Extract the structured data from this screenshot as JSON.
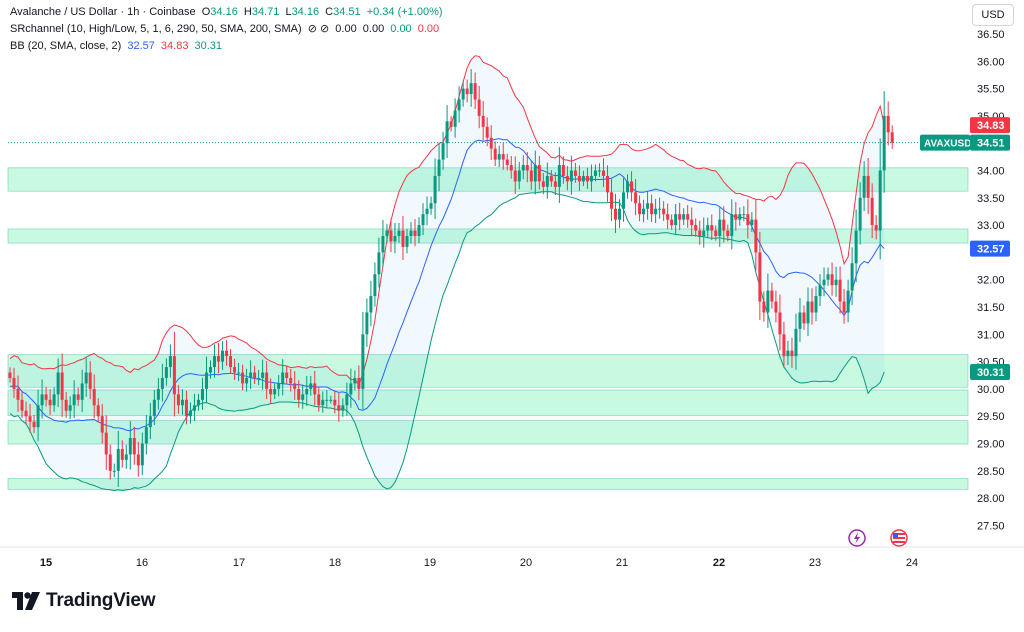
{
  "legend": {
    "symbol_title": "Avalanche / US Dollar · 1h · Coinbase",
    "o_label": "O",
    "o_val": "34.16",
    "h_label": "H",
    "h_val": "34.71",
    "l_label": "L",
    "l_val": "34.16",
    "c_label": "C",
    "c_val": "34.51",
    "change": "+0.34 (+1.00%)",
    "sr_title": "SRchannel (10, High/Low, 5, 1, 6, 290, 50, SMA, 200, SMA)",
    "sr_symbols": "⊘ ⊘",
    "sr_v1": "0.00",
    "sr_v2": "0.00",
    "sr_v3": "0.00",
    "sr_v4": "0.00",
    "bb_title": "BB (20, SMA, close, 2)",
    "bb_basis": "32.57",
    "bb_upper": "34.83",
    "bb_lower": "30.31"
  },
  "currency_button": "USD",
  "branding": {
    "logo_text": "TradingView"
  },
  "chart_data": {
    "type": "candlestick",
    "symbol": "AVAXUSD",
    "x_ticks": [
      "15",
      "16",
      "17",
      "18",
      "19",
      "20",
      "21",
      "22",
      "23",
      "24"
    ],
    "y_ticks": [
      "36.50",
      "36.00",
      "35.50",
      "35.00",
      "34.50",
      "34.00",
      "33.50",
      "33.00",
      "32.50",
      "32.00",
      "31.50",
      "31.00",
      "30.50",
      "30.00",
      "29.50",
      "29.00",
      "28.50",
      "28.00",
      "27.50"
    ],
    "ylim": [
      27.3,
      36.8
    ],
    "price_labels": [
      {
        "text": "34.83",
        "value": 34.83,
        "color": "#f23645"
      },
      {
        "text": "34.51",
        "value": 34.51,
        "color": "#089981",
        "symbol": "AVAXUSD"
      },
      {
        "text": "32.57",
        "value": 32.57,
        "color": "#2962ff"
      },
      {
        "text": "30.31",
        "value": 30.31,
        "color": "#089981"
      }
    ],
    "sr_zones": [
      [
        33.62,
        34.05
      ],
      [
        32.67,
        32.93
      ],
      [
        30.03,
        30.63
      ],
      [
        29.51,
        29.98
      ],
      [
        28.99,
        29.42
      ],
      [
        28.16,
        28.36
      ]
    ],
    "close": [
      30.2,
      30.0,
      29.8,
      29.6,
      29.5,
      29.4,
      29.3,
      29.7,
      29.9,
      29.8,
      29.7,
      29.9,
      30.3,
      29.8,
      29.6,
      29.7,
      29.9,
      29.8,
      30.1,
      30.3,
      30.0,
      29.7,
      29.5,
      29.2,
      28.8,
      28.5,
      28.5,
      28.9,
      28.7,
      28.8,
      29.1,
      28.8,
      28.6,
      29.0,
      29.3,
      29.5,
      29.8,
      30.0,
      30.2,
      30.4,
      30.6,
      29.9,
      29.7,
      29.8,
      29.5,
      29.6,
      29.7,
      29.8,
      30.0,
      30.3,
      30.4,
      30.6,
      30.5,
      30.7,
      30.6,
      30.4,
      30.3,
      30.3,
      30.1,
      30.2,
      30.3,
      30.2,
      30.2,
      30.3,
      30.0,
      29.9,
      30.0,
      30.1,
      30.3,
      30.2,
      30.1,
      30.0,
      29.8,
      29.9,
      30.0,
      30.1,
      29.9,
      29.7,
      29.8,
      29.8,
      29.8,
      29.7,
      29.6,
      29.7,
      29.9,
      30.1,
      30.2,
      30.0,
      31.0,
      31.4,
      31.7,
      32.1,
      32.5,
      32.8,
      32.9,
      32.7,
      32.8,
      32.9,
      32.6,
      32.8,
      32.9,
      32.8,
      33.0,
      33.2,
      33.3,
      33.4,
      33.9,
      34.2,
      34.5,
      34.9,
      34.8,
      35.1,
      35.3,
      35.5,
      35.4,
      35.6,
      35.3,
      35.0,
      34.8,
      34.6,
      34.4,
      34.2,
      34.3,
      34.2,
      34.1,
      34.0,
      33.8,
      34.0,
      34.1,
      34.0,
      33.8,
      34.1,
      33.8,
      33.7,
      33.9,
      33.8,
      33.7,
      34.1,
      33.9,
      33.8,
      34.0,
      33.9,
      33.8,
      33.9,
      33.8,
      33.9,
      34.0,
      34.0,
      33.9,
      33.6,
      33.3,
      33.1,
      33.3,
      33.6,
      33.8,
      33.6,
      33.4,
      33.2,
      33.3,
      33.4,
      33.2,
      33.3,
      33.3,
      33.2,
      33.1,
      33.0,
      33.2,
      33.1,
      33.2,
      33.1,
      33.0,
      32.9,
      32.8,
      32.9,
      33.0,
      32.9,
      32.8,
      33.1,
      32.9,
      32.8,
      33.2,
      33.1,
      33.2,
      33.2,
      33.0,
      33.1,
      32.5,
      31.6,
      31.4,
      31.8,
      31.6,
      31.4,
      31.0,
      30.6,
      30.7,
      30.6,
      31.1,
      31.4,
      31.2,
      31.6,
      31.4,
      31.7,
      31.9,
      32.0,
      32.1,
      31.9,
      32.0,
      31.6,
      31.4,
      31.8,
      32.3,
      32.9,
      33.5,
      33.9,
      33.5,
      33.0,
      32.9,
      34.0,
      35.0,
      34.7,
      34.51
    ],
    "bb_upper": [
      30.55,
      30.61,
      30.58,
      30.48,
      30.46,
      30.44,
      30.46,
      30.4,
      30.37,
      30.37,
      30.38,
      30.37,
      30.41,
      30.44,
      30.43,
      30.46,
      30.48,
      30.52,
      30.54,
      30.58,
      30.62,
      30.65,
      30.59,
      30.56,
      30.5,
      30.48,
      30.43,
      30.42,
      30.41,
      30.34,
      30.3,
      30.37,
      30.35,
      30.4,
      30.43,
      30.48,
      30.53,
      30.66,
      30.89,
      31.03,
      31.12,
      31.17,
      31.15,
      31.12,
      31.06,
      30.98,
      30.88,
      30.8,
      30.76,
      30.76,
      30.79,
      30.84,
      30.87,
      30.93,
      30.95,
      30.97,
      30.96,
      30.91,
      30.88,
      30.84,
      30.77,
      30.73,
      30.68,
      30.62,
      30.55,
      30.51,
      30.48,
      30.44,
      30.43,
      30.42,
      30.39,
      30.4,
      30.41,
      30.39,
      30.38,
      30.41,
      30.39,
      30.4,
      30.4,
      30.42,
      30.34,
      30.29,
      30.25,
      30.25,
      30.25,
      30.17,
      30.17,
      30.07,
      30.28,
      30.54,
      30.88,
      31.26,
      31.77,
      32.25,
      32.73,
      33.08,
      33.37,
      33.61,
      33.77,
      33.91,
      33.98,
      34.03,
      34.06,
      34.17,
      34.26,
      34.36,
      34.43,
      34.5,
      34.52,
      34.69,
      34.84,
      35.08,
      35.36,
      35.62,
      35.88,
      36.03,
      36.1,
      36.09,
      35.98,
      35.95,
      35.92,
      35.87,
      35.82,
      35.73,
      35.7,
      35.52,
      35.36,
      35.27,
      35.16,
      34.96,
      34.77,
      34.59,
      34.44,
      34.38,
      34.32,
      34.24,
      34.23,
      34.28,
      34.2,
      34.19,
      34.17,
      34.2,
      34.23,
      34.25,
      34.27,
      34.26,
      34.26,
      34.26,
      34.27,
      34.28,
      34.3,
      34.37,
      34.47,
      34.48,
      34.47,
      34.4,
      34.36,
      34.36,
      34.38,
      34.4,
      34.43,
      34.48,
      34.43,
      34.38,
      34.31,
      34.26,
      34.23,
      34.19,
      34.18,
      34.11,
      34.08,
      34.04,
      34.03,
      34.05,
      34.03,
      34.0,
      33.99,
      33.9,
      33.79,
      33.71,
      33.64,
      33.58,
      33.58,
      33.55,
      33.53,
      33.5,
      33.47,
      33.47,
      33.44,
      33.51,
      33.53,
      33.47,
      33.54,
      33.68,
      33.91,
      34.05,
      34.14,
      34.14,
      34.13,
      34.05,
      33.94,
      33.8,
      33.66,
      33.48,
      33.3,
      33.11,
      32.88,
      32.61,
      32.29,
      32.42,
      33.0,
      33.58,
      34.13,
      34.49,
      34.69,
      34.8,
      35.01,
      35.18,
      34.83
    ],
    "bb_lower": [
      29.55,
      29.49,
      29.51,
      29.42,
      29.36,
      29.23,
      29.06,
      28.94,
      28.78,
      28.63,
      28.55,
      28.48,
      28.41,
      28.37,
      28.35,
      28.37,
      28.36,
      28.34,
      28.3,
      28.28,
      28.25,
      28.23,
      28.2,
      28.17,
      28.16,
      28.15,
      28.14,
      28.15,
      28.14,
      28.15,
      28.16,
      28.19,
      28.18,
      28.2,
      28.22,
      28.27,
      28.35,
      28.42,
      28.49,
      28.59,
      28.81,
      29.0,
      29.21,
      29.35,
      29.48,
      29.58,
      29.66,
      29.71,
      29.74,
      29.75,
      29.72,
      29.7,
      29.65,
      29.62,
      29.61,
      29.6,
      29.59,
      29.61,
      29.61,
      29.62,
      29.64,
      29.65,
      29.68,
      29.7,
      29.71,
      29.73,
      29.74,
      29.76,
      29.76,
      29.76,
      29.76,
      29.75,
      29.75,
      29.74,
      29.72,
      29.7,
      29.68,
      29.67,
      29.67,
      29.65,
      29.65,
      29.63,
      29.62,
      29.64,
      29.6,
      29.52,
      29.38,
      29.18,
      28.94,
      28.75,
      28.58,
      28.41,
      28.3,
      28.21,
      28.17,
      28.19,
      28.29,
      28.46,
      28.65,
      28.91,
      29.21,
      29.54,
      29.86,
      30.2,
      30.54,
      30.88,
      31.18,
      31.46,
      31.72,
      31.9,
      32.1,
      32.3,
      32.48,
      32.7,
      32.86,
      32.9,
      32.97,
      33.02,
      33.09,
      33.15,
      33.19,
      33.27,
      33.35,
      33.4,
      33.43,
      33.47,
      33.5,
      33.56,
      33.57,
      33.58,
      33.59,
      33.59,
      33.6,
      33.61,
      33.61,
      33.61,
      33.58,
      33.56,
      33.55,
      33.53,
      33.51,
      33.49,
      33.46,
      33.43,
      33.43,
      33.42,
      33.41,
      33.41,
      33.41,
      33.41,
      33.42,
      33.42,
      33.41,
      33.29,
      33.09,
      32.97,
      32.89,
      32.84,
      32.82,
      32.84,
      32.84,
      32.84,
      32.85,
      32.86,
      32.86,
      32.84,
      32.83,
      32.82,
      32.81,
      32.81,
      32.81,
      32.81,
      32.79,
      32.79,
      32.77,
      32.76,
      32.76,
      32.77,
      32.75,
      32.74,
      32.73,
      32.71,
      32.7,
      32.72,
      32.68,
      32.46,
      32.13,
      31.87,
      31.59,
      31.36,
      31.09,
      30.84,
      30.59,
      30.4,
      30.3,
      30.2,
      30.14,
      30.11,
      30.11,
      30.12,
      30.14,
      30.14,
      30.13,
      30.14,
      30.14,
      30.13,
      30.17,
      30.29,
      30.4,
      30.5,
      30.59,
      30.57,
      30.4,
      30.18,
      29.92,
      30.01,
      30.05,
      30.12,
      30.31
    ]
  }
}
